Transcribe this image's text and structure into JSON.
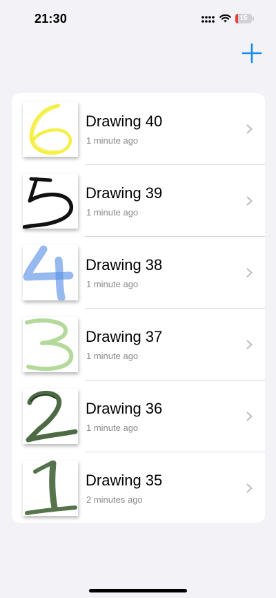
{
  "status_bar": {
    "time": "21:30",
    "battery": "15",
    "battery_level": 0.15,
    "battery_color": "#e5403a"
  },
  "nav": {
    "add_icon": "plus-icon",
    "accent": "#1a8cf0"
  },
  "drawings": [
    {
      "title": "Drawing 40",
      "subtitle": "1 minute ago",
      "thumbnail_glyph": "6",
      "ink_color": "#f4ee3c"
    },
    {
      "title": "Drawing 39",
      "subtitle": "1 minute ago",
      "thumbnail_glyph": "5",
      "ink_color": "#111111"
    },
    {
      "title": "Drawing 38",
      "subtitle": "1 minute ago",
      "thumbnail_glyph": "4",
      "ink_color": "#5d94e6"
    },
    {
      "title": "Drawing 37",
      "subtitle": "1 minute ago",
      "thumbnail_glyph": "3",
      "ink_color": "#a6d48a"
    },
    {
      "title": "Drawing 36",
      "subtitle": "1 minute ago",
      "thumbnail_glyph": "2",
      "ink_color": "#4d6a45"
    },
    {
      "title": "Drawing 35",
      "subtitle": "2 minutes ago",
      "thumbnail_glyph": "1",
      "ink_color": "#56744b"
    }
  ]
}
